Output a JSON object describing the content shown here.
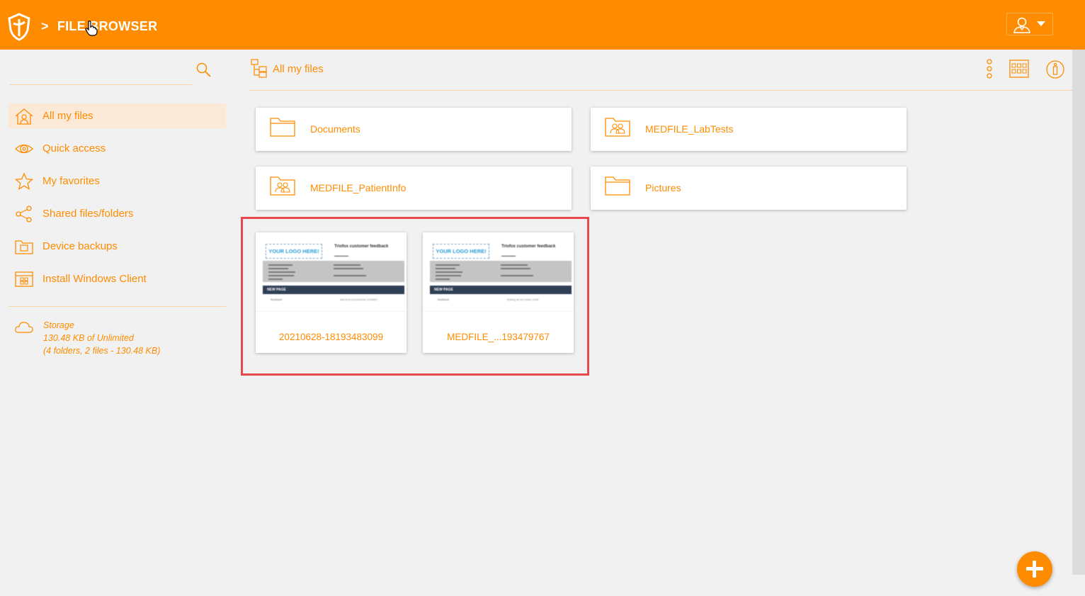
{
  "header": {
    "separator": ">",
    "title": "FILE BROWSER",
    "logo_icon": "shield-logo-icon",
    "user_icon": "user-icon",
    "accent_color": "#ff8c00"
  },
  "sidebar": {
    "items": [
      {
        "label": "All my files",
        "icon": "home-icon",
        "active": true
      },
      {
        "label": "Quick access",
        "icon": "eye-icon",
        "active": false
      },
      {
        "label": "My favorites",
        "icon": "star-icon",
        "active": false
      },
      {
        "label": "Shared files/folders",
        "icon": "share-icon",
        "active": false
      },
      {
        "label": "Device backups",
        "icon": "backup-folder-icon",
        "active": false
      },
      {
        "label": "Install Windows Client",
        "icon": "window-client-icon",
        "active": false
      }
    ],
    "storage": {
      "title": "Storage",
      "usage": "130.48 KB of Unlimited",
      "details": "(4 folders, 2 files - 130.48 KB)"
    }
  },
  "toolbar": {
    "title": "All my files"
  },
  "folders": [
    {
      "name": "Documents",
      "icon": "folder-icon"
    },
    {
      "name": "MEDFILE_LabTests",
      "icon": "shared-folder-icon"
    },
    {
      "name": "MEDFILE_PatientInfo",
      "icon": "shared-folder-icon"
    },
    {
      "name": "Pictures",
      "icon": "folder-icon"
    }
  ],
  "files": [
    {
      "name": "20210628-18193483099",
      "thumb": {
        "logo": "YOUR LOGO HERE!",
        "title": "Triofox customer feedback",
        "section": "NEW PAGE",
        "row_label": "feedback",
        "row_value": "test from proceforms 1234567"
      }
    },
    {
      "name": "MEDFILE_...193479767",
      "thumb": {
        "logo": "YOUR LOGO HERE!",
        "title": "Triofox customer feedback",
        "section": "NEW PAGE",
        "row_label": "feedback",
        "row_value": "testing all via mobo 1234"
      }
    }
  ]
}
